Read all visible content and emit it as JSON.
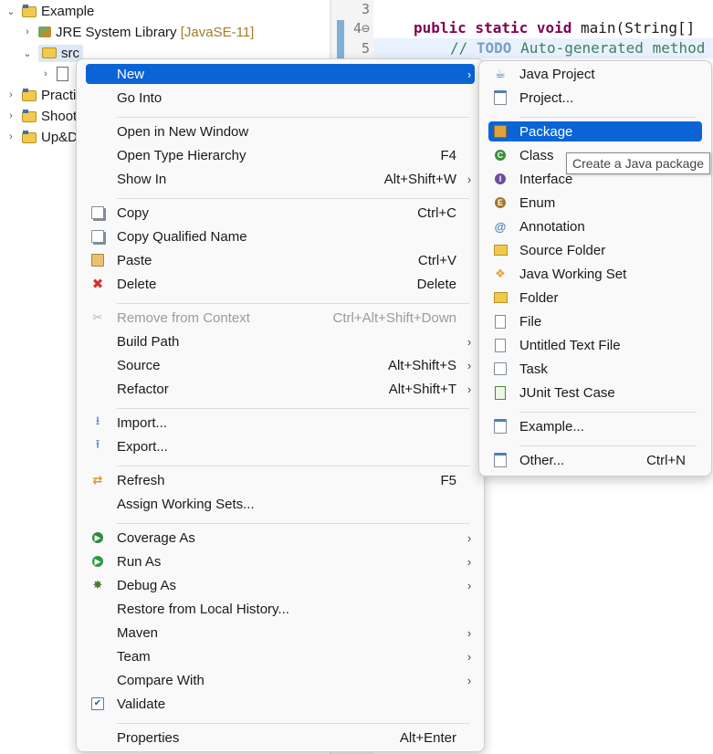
{
  "tree": {
    "project": "Example",
    "jre": "JRE System Library",
    "jre_version": "[JavaSE-11]",
    "src": "src",
    "other_projects": [
      "Practic",
      "Shoot",
      "Up&D"
    ]
  },
  "editor": {
    "line_numbers": [
      "3",
      "4⊖",
      "5"
    ],
    "line4_kw": "public static void",
    "line4_rest": " main(String[]",
    "line5_prefix": "// ",
    "line5_todo": "TODO",
    "line5_rest": " Auto-generated method"
  },
  "context_menu": {
    "items": [
      {
        "label": "New",
        "shortcut": "",
        "submenu": true,
        "icon": "none"
      },
      {
        "label": "Go Into",
        "shortcut": "",
        "submenu": false,
        "icon": "none"
      },
      {
        "label": "Open in New Window",
        "shortcut": "",
        "submenu": false,
        "icon": "none"
      },
      {
        "label": "Open Type Hierarchy",
        "shortcut": "F4",
        "submenu": false,
        "icon": "none"
      },
      {
        "label": "Show In",
        "shortcut": "Alt+Shift+W",
        "submenu": true,
        "icon": "none"
      },
      {
        "label": "Copy",
        "shortcut": "Ctrl+C",
        "submenu": false,
        "icon": "copy-icon"
      },
      {
        "label": "Copy Qualified Name",
        "shortcut": "",
        "submenu": false,
        "icon": "copy-qualified-icon"
      },
      {
        "label": "Paste",
        "shortcut": "Ctrl+V",
        "submenu": false,
        "icon": "paste-icon"
      },
      {
        "label": "Delete",
        "shortcut": "Delete",
        "submenu": false,
        "icon": "delete-icon"
      },
      {
        "label": "Remove from Context",
        "shortcut": "Ctrl+Alt+Shift+Down",
        "submenu": false,
        "icon": "remove-context-icon",
        "disabled": true
      },
      {
        "label": "Build Path",
        "shortcut": "",
        "submenu": true,
        "icon": "none"
      },
      {
        "label": "Source",
        "shortcut": "Alt+Shift+S",
        "submenu": true,
        "icon": "none"
      },
      {
        "label": "Refactor",
        "shortcut": "Alt+Shift+T",
        "submenu": true,
        "icon": "none"
      },
      {
        "label": "Import...",
        "shortcut": "",
        "submenu": false,
        "icon": "import-icon"
      },
      {
        "label": "Export...",
        "shortcut": "",
        "submenu": false,
        "icon": "export-icon"
      },
      {
        "label": "Refresh",
        "shortcut": "F5",
        "submenu": false,
        "icon": "refresh-icon"
      },
      {
        "label": "Assign Working Sets...",
        "shortcut": "",
        "submenu": false,
        "icon": "none"
      },
      {
        "label": "Coverage As",
        "shortcut": "",
        "submenu": true,
        "icon": "coverage-icon"
      },
      {
        "label": "Run As",
        "shortcut": "",
        "submenu": true,
        "icon": "run-icon"
      },
      {
        "label": "Debug As",
        "shortcut": "",
        "submenu": true,
        "icon": "debug-icon"
      },
      {
        "label": "Restore from Local History...",
        "shortcut": "",
        "submenu": false,
        "icon": "none"
      },
      {
        "label": "Maven",
        "shortcut": "",
        "submenu": true,
        "icon": "none"
      },
      {
        "label": "Team",
        "shortcut": "",
        "submenu": true,
        "icon": "none"
      },
      {
        "label": "Compare With",
        "shortcut": "",
        "submenu": true,
        "icon": "none"
      },
      {
        "label": "Validate",
        "shortcut": "",
        "submenu": false,
        "icon": "check-icon"
      },
      {
        "label": "Properties",
        "shortcut": "Alt+Enter",
        "submenu": false,
        "icon": "none"
      }
    ]
  },
  "new_submenu": {
    "items": [
      {
        "label": "Java Project",
        "shortcut": "",
        "icon": "java-project-icon"
      },
      {
        "label": "Project...",
        "shortcut": "",
        "icon": "project-icon"
      },
      {
        "label": "Package",
        "shortcut": "",
        "icon": "package-icon"
      },
      {
        "label": "Class",
        "shortcut": "",
        "icon": "class-icon"
      },
      {
        "label": "Interface",
        "shortcut": "",
        "icon": "interface-icon"
      },
      {
        "label": "Enum",
        "shortcut": "",
        "icon": "enum-icon"
      },
      {
        "label": "Annotation",
        "shortcut": "",
        "icon": "annotation-icon"
      },
      {
        "label": "Source Folder",
        "shortcut": "",
        "icon": "source-folder-icon"
      },
      {
        "label": "Java Working Set",
        "shortcut": "",
        "icon": "working-set-icon"
      },
      {
        "label": "Folder",
        "shortcut": "",
        "icon": "folder-icon"
      },
      {
        "label": "File",
        "shortcut": "",
        "icon": "file-icon"
      },
      {
        "label": "Untitled Text File",
        "shortcut": "",
        "icon": "text-file-icon"
      },
      {
        "label": "Task",
        "shortcut": "",
        "icon": "task-icon"
      },
      {
        "label": "JUnit Test Case",
        "shortcut": "",
        "icon": "junit-icon"
      },
      {
        "label": "Example...",
        "shortcut": "",
        "icon": "example-icon"
      },
      {
        "label": "Other...",
        "shortcut": "Ctrl+N",
        "icon": "other-icon"
      }
    ]
  },
  "tooltip": "Create a Java package",
  "colors": {
    "highlight": "#0a64d6",
    "keyword": "#7f0055",
    "comment": "#3f7f5f"
  }
}
